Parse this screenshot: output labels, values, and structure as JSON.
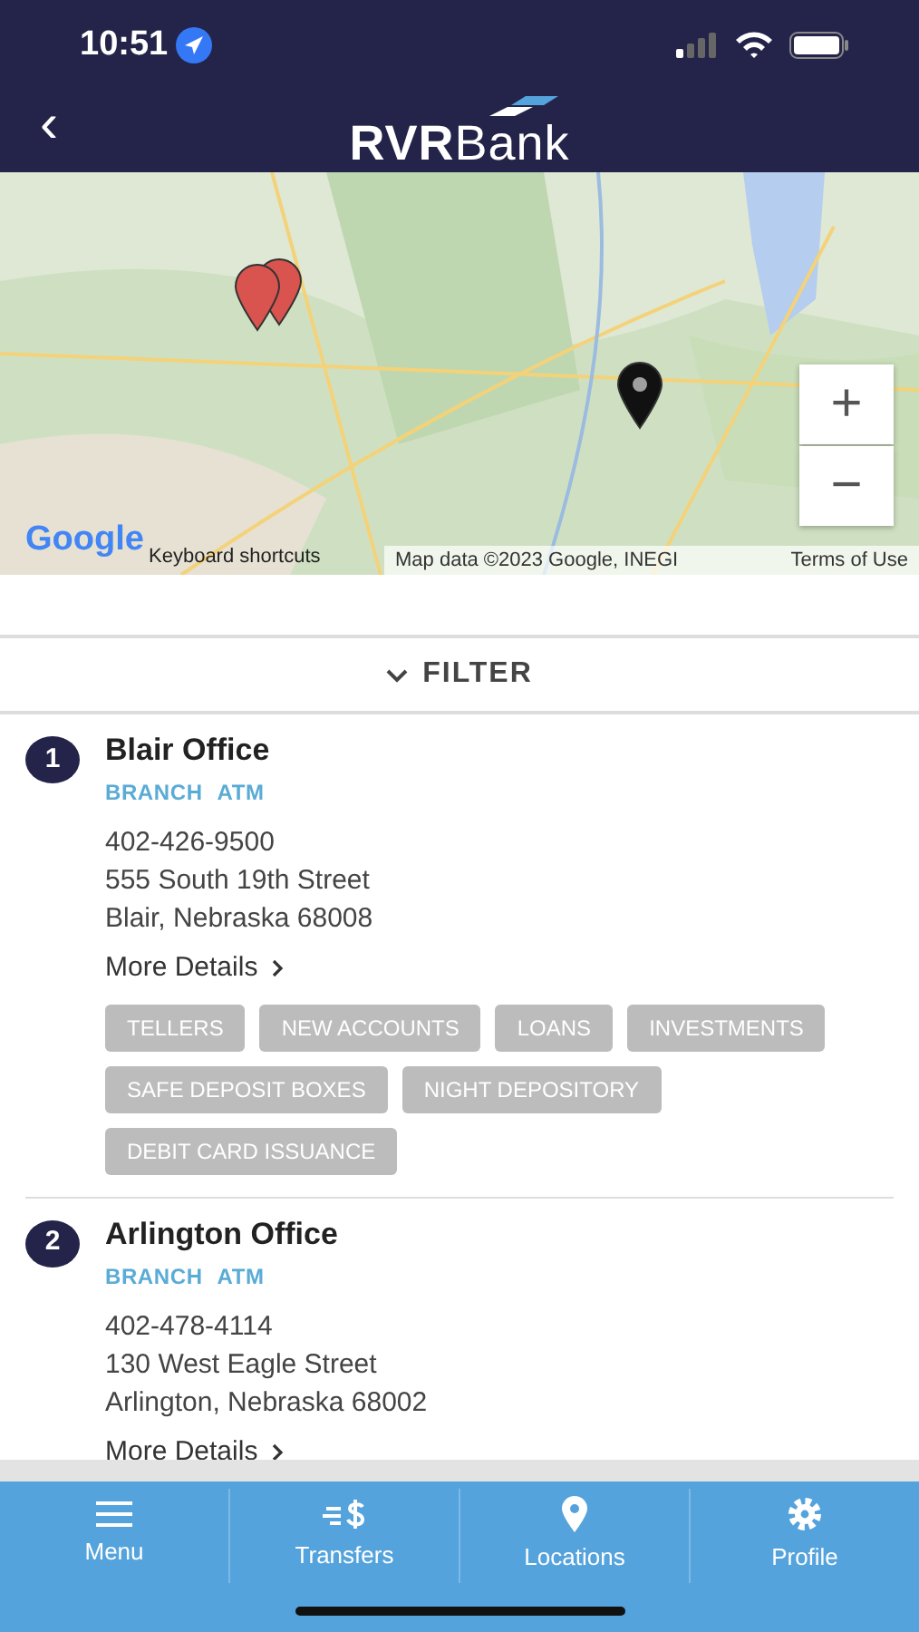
{
  "status_bar": {
    "time": "10:51"
  },
  "header": {
    "back": "‹",
    "logo": "**RVR**Bank"
  },
  "map": {
    "kind": "picture",
    "zoom_in": "+",
    "zoom_out": "−",
    "attribution": {
      "logo": "Google",
      "shortcuts": "Keyboard shortcuts",
      "data": "Map data ©2023 Google, INEGI",
      "terms": "Terms of Use"
    }
  },
  "filter": {
    "label": "FILTER",
    "expanded": false
  },
  "locations": [
    {
      "number": "1",
      "name": "Blair Office",
      "types": [
        "BRANCH",
        "ATM"
      ],
      "phone": "402-426-9500",
      "address": [
        "555 South 19th Street",
        "Blair, Nebraska 68008"
      ],
      "more": "More Details",
      "services": [
        "TELLERS",
        "NEW ACCOUNTS",
        "LOANS",
        "INVESTMENTS",
        "SAFE DEPOSIT BOXES",
        "NIGHT DEPOSITORY",
        "DEBIT CARD ISSUANCE"
      ]
    },
    {
      "number": "2",
      "name": "Arlington Office",
      "types": [
        "BRANCH",
        "ATM"
      ],
      "phone": "402-478-4114",
      "address": [
        "130 West Eagle Street",
        "Arlington, Nebraska 68002"
      ],
      "more": "More Details"
    }
  ],
  "tab_bar": [
    {
      "kind": "menu",
      "label": "Menu"
    },
    {
      "kind": "transfers",
      "label": "Transfers"
    },
    {
      "kind": "locations",
      "label": "Locations"
    },
    {
      "kind": "profile",
      "label": "Profile"
    }
  ]
}
